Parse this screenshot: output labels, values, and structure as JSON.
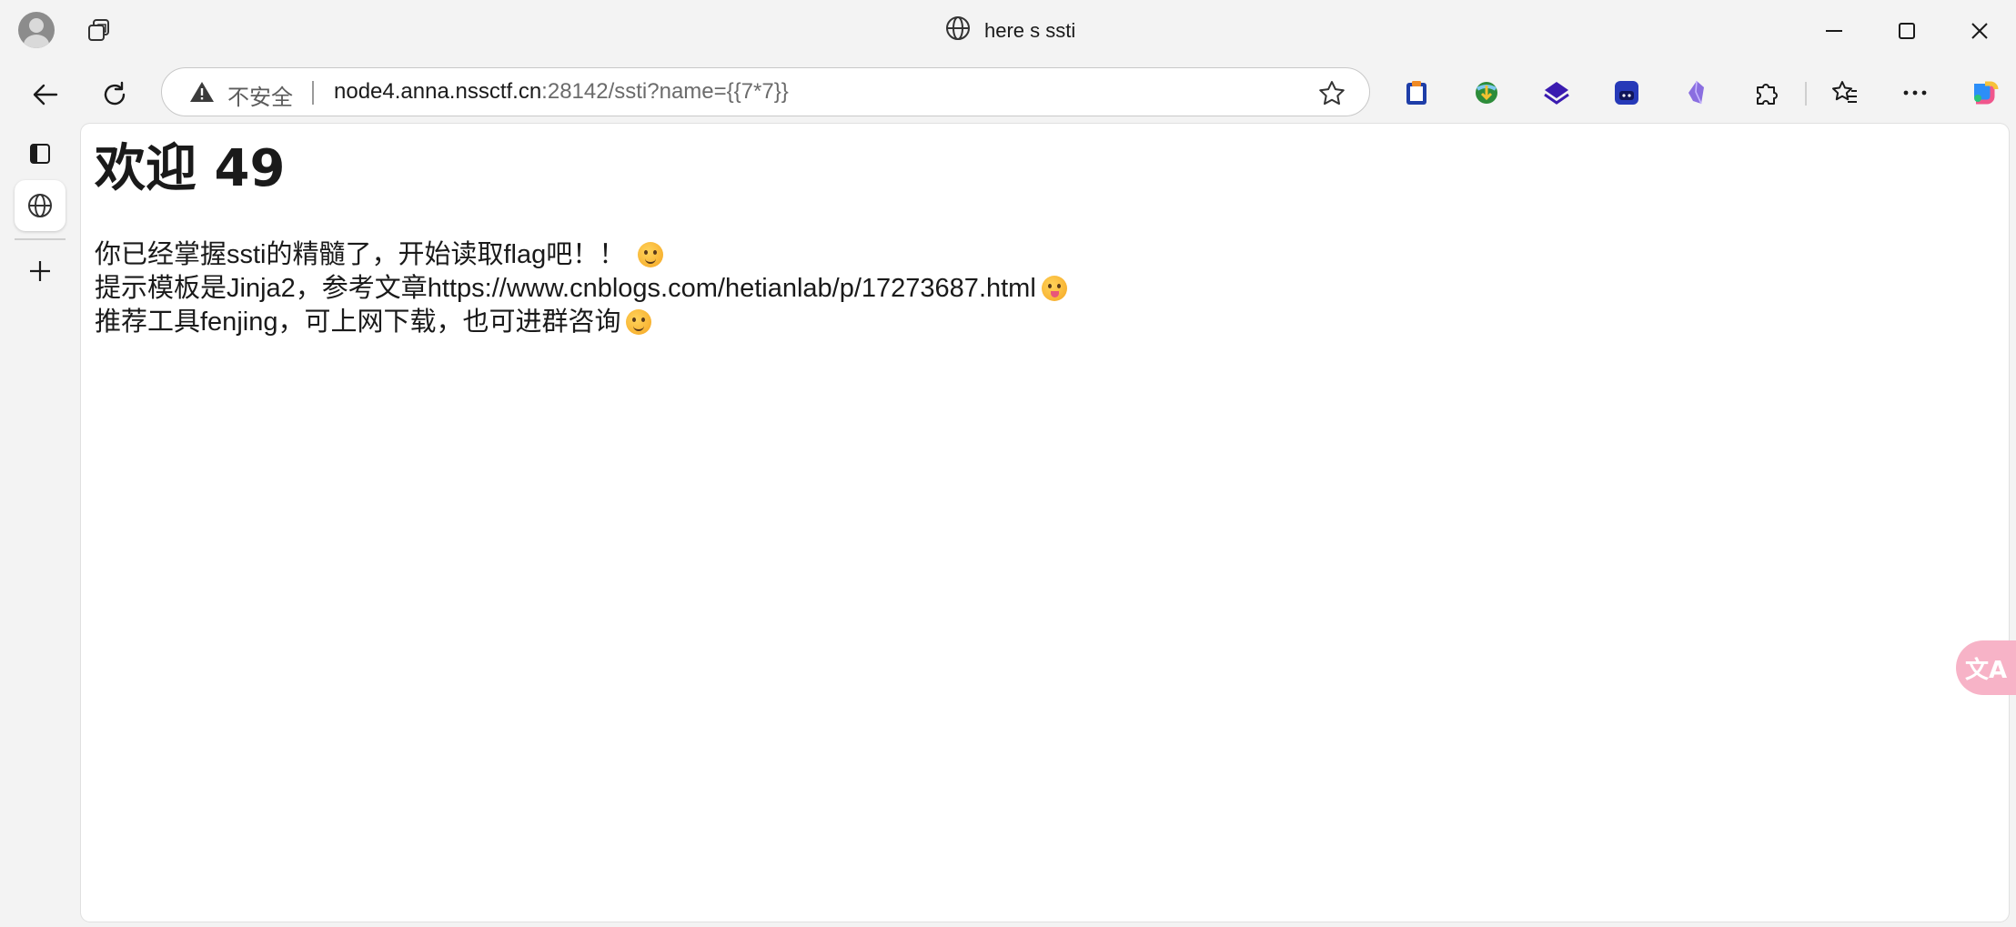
{
  "window": {
    "tab_title": "here s ssti"
  },
  "toolbar": {
    "security_label": "不安全",
    "url_host": "node4.anna.nssctf.cn",
    "url_rest": ":28142/ssti?name={{7*7}}"
  },
  "page": {
    "heading": "欢迎 49",
    "line1": "你已经掌握ssti的精髓了，开始读取flag吧！！",
    "line2": "提示模板是Jinja2，参考文章https://www.cnblogs.com/hetianlab/p/17273687.html",
    "line3": "推荐工具fenjing，可上网下载，也可进群咨询"
  },
  "translate_button": {
    "label": "文A"
  },
  "colors": {
    "chrome_bg": "#f3f3f3",
    "page_bg": "#ffffff",
    "url_dim": "#6b6b6b",
    "translate_pink": "#f7b3c7"
  },
  "icons": {
    "profile": "avatar",
    "workspaces": "workspaces-icon",
    "globe": "globe-icon",
    "minimize": "minimize-icon",
    "maximize": "maximize-icon",
    "close": "close-icon",
    "back": "back-arrow-icon",
    "refresh": "refresh-icon",
    "warning": "warning-icon",
    "favorite": "star-icon",
    "extensions": [
      "clipboard-extension-icon",
      "globe-download-extension-icon",
      "layers-extension-icon",
      "game-extension-icon",
      "crystal-extension-icon",
      "puzzle-icon"
    ],
    "favorites": "favorites-icon",
    "more": "more-icon",
    "copilot": "copilot-icon",
    "tab_actions": "tab-actions-icon",
    "new_tab": "plus-icon"
  }
}
